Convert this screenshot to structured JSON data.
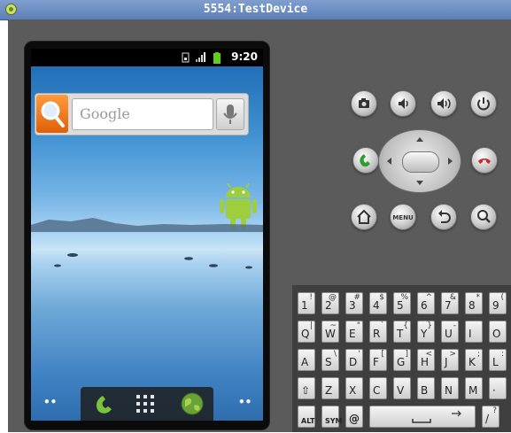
{
  "window": {
    "title": "5554:TestDevice"
  },
  "status_bar": {
    "time": "9:20"
  },
  "search_widget": {
    "placeholder": "Google"
  },
  "keyboard": {
    "rows": [
      [
        {
          "m": "1",
          "s": "!"
        },
        {
          "m": "2",
          "s": "@"
        },
        {
          "m": "3",
          "s": "#"
        },
        {
          "m": "4",
          "s": "$"
        },
        {
          "m": "5",
          "s": "%"
        },
        {
          "m": "6",
          "s": "^"
        },
        {
          "m": "7",
          "s": "&"
        },
        {
          "m": "8",
          "s": "*"
        },
        {
          "m": "9",
          "s": "("
        }
      ],
      [
        {
          "m": "Q",
          "s": "|"
        },
        {
          "m": "W",
          "s": "~"
        },
        {
          "m": "E",
          "s": "\""
        },
        {
          "m": "R",
          "s": "`"
        },
        {
          "m": "T",
          "s": "{"
        },
        {
          "m": "Y",
          "s": "}"
        },
        {
          "m": "U",
          "s": "-"
        },
        {
          "m": "I",
          "s": ""
        },
        {
          "m": "O",
          "s": ""
        }
      ],
      [
        {
          "m": "A",
          "s": ""
        },
        {
          "m": "S",
          "s": "\\"
        },
        {
          "m": "D",
          "s": "'"
        },
        {
          "m": "F",
          "s": "["
        },
        {
          "m": "G",
          "s": "]"
        },
        {
          "m": "H",
          "s": "<"
        },
        {
          "m": "J",
          "s": ">"
        },
        {
          "m": "K",
          "s": ";"
        },
        {
          "m": "L",
          "s": ":"
        }
      ],
      [
        {
          "m": "⇧",
          "s": ""
        },
        {
          "m": "Z",
          "s": ""
        },
        {
          "m": "X",
          "s": ""
        },
        {
          "m": "C",
          "s": ""
        },
        {
          "m": "V",
          "s": ""
        },
        {
          "m": "B",
          "s": ""
        },
        {
          "m": "N",
          "s": ""
        },
        {
          "m": "M",
          "s": ""
        },
        {
          "m": "·",
          "s": ""
        }
      ]
    ],
    "bottom": {
      "alt": "ALT",
      "sym": "SYM",
      "at": "@",
      "slash": "/",
      "question": "?"
    }
  }
}
